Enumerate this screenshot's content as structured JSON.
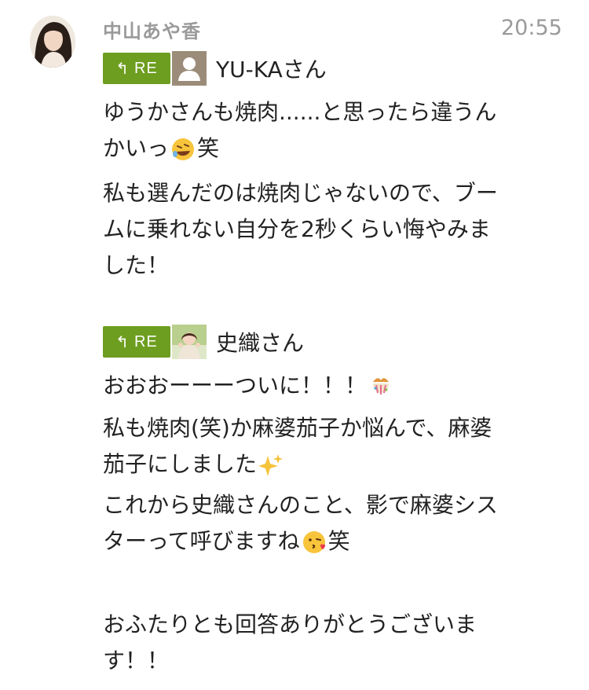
{
  "post": {
    "author": "中山あや香",
    "time": "20:55"
  },
  "replies": [
    {
      "badge": "RE",
      "name": "YU-KAさん",
      "lines": [
        "ゆうかさんも焼肉......と思ったら違うん",
        "かいっ",
        "笑",
        "私も選んだのは焼肉じゃないので、ブー",
        "ムに乗れない自分を2秒くらい悔やみま",
        "した！"
      ],
      "emoji": "rolling-on-floor-laughing-icon"
    },
    {
      "badge": "RE",
      "name": "史織さん",
      "lines": [
        "おおおーーーついに！！！",
        "私も焼肉(笑)か麻婆茄子か悩んで、麻婆",
        "茄子にしました",
        "これから史織さんのこと、影で麻婆シス",
        "ターって呼びますね",
        "笑"
      ],
      "emojis": [
        "confetti-ball-icon",
        "sparkles-icon",
        "kissing-face-icon"
      ]
    }
  ],
  "closing": [
    "おふたりとも回答ありがとうございま",
    "す！！"
  ],
  "colors": {
    "badge": "#6d9e20",
    "meta_text": "#9a9a9a",
    "body_text": "#222222"
  }
}
